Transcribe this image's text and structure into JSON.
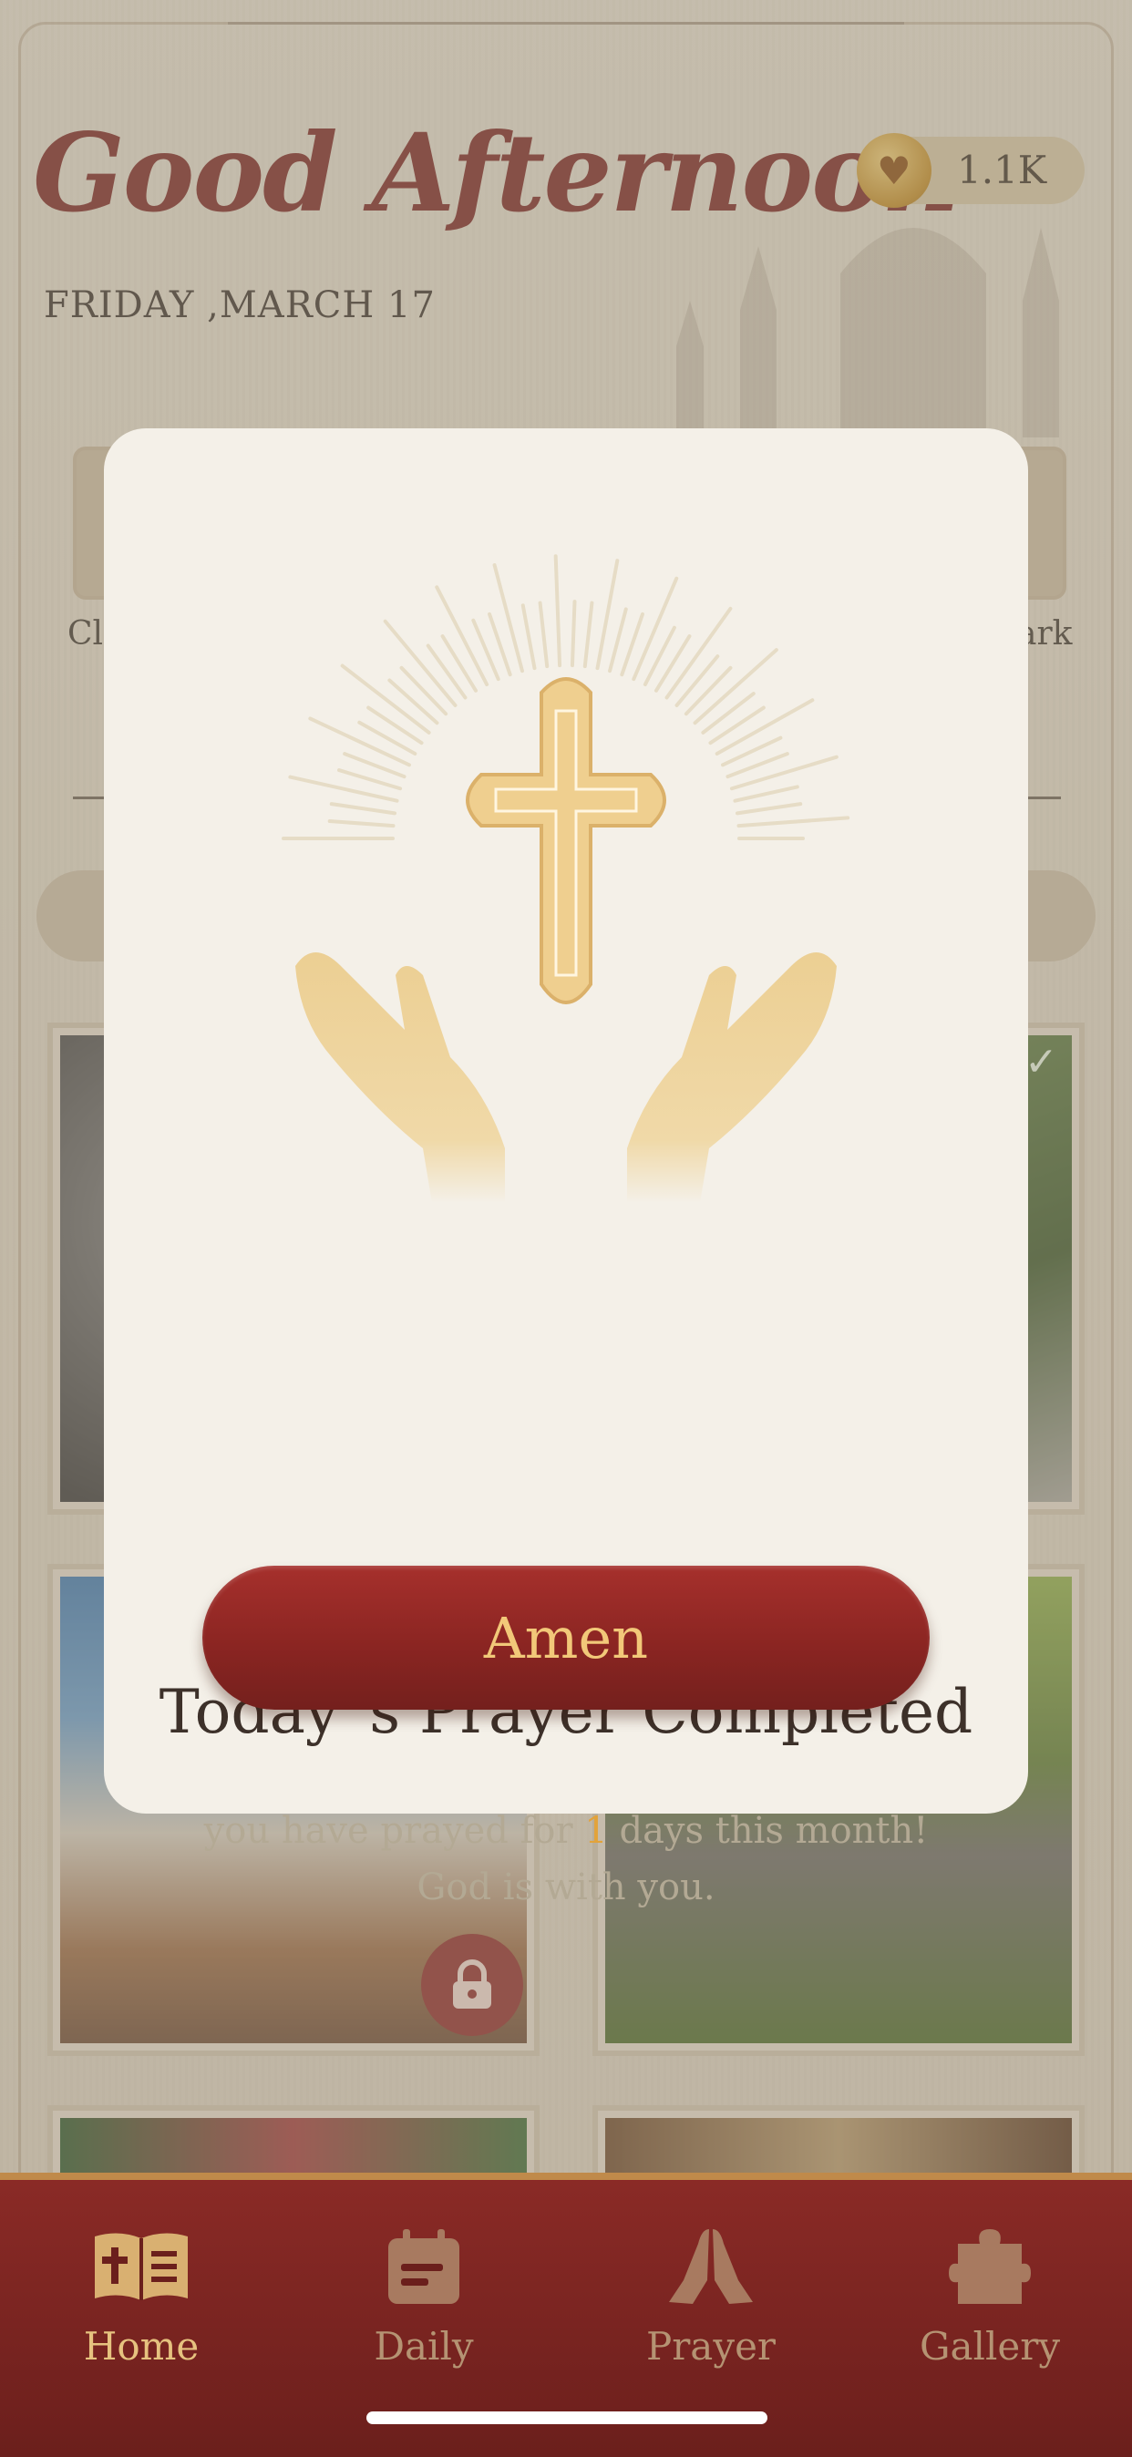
{
  "header": {
    "greeting": "Good Afternoon",
    "date": "FRIDAY ,MARCH 17",
    "coins": "1.1K"
  },
  "categories": {
    "left_partial": "Cl",
    "right_partial": "ark"
  },
  "modal": {
    "title": "Today`s Prayer Completed",
    "message_before": "you have prayed for",
    "count": "1",
    "message_after": "days this month!",
    "message_line2": "God is with you.",
    "button": "Amen"
  },
  "tabs": [
    {
      "label": "Home",
      "icon": "bible-icon",
      "active": true
    },
    {
      "label": "Daily",
      "icon": "calendar-icon",
      "active": false
    },
    {
      "label": "Prayer",
      "icon": "praying-hands-icon",
      "active": false
    },
    {
      "label": "Gallery",
      "icon": "puzzle-icon",
      "active": false
    }
  ],
  "colors": {
    "accent": "#8b2522",
    "gold": "#f2c879",
    "highlight": "#e2a33b"
  }
}
